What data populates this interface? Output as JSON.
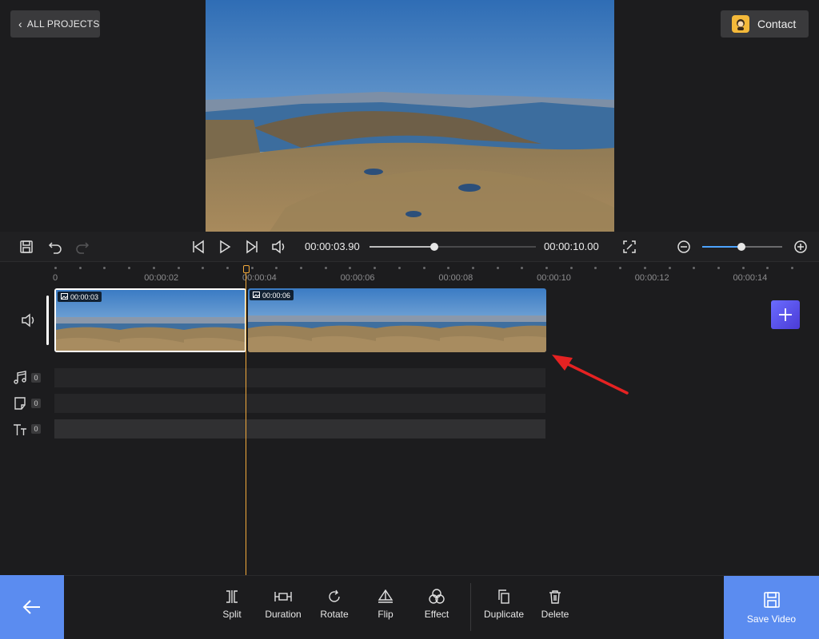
{
  "header": {
    "all_projects_label": "ALL PROJECTS",
    "contact_label": "Contact"
  },
  "transport": {
    "current_time": "00:00:03.90",
    "total_time": "00:00:10.00",
    "progress_fraction": 0.39,
    "zoom_fraction": 0.49,
    "icons": [
      "save-icon",
      "undo-icon",
      "redo-icon",
      "skip-back-icon",
      "play-icon",
      "skip-forward-icon",
      "volume-icon",
      "fullscreen-icon",
      "zoom-out-icon",
      "zoom-in-icon"
    ]
  },
  "ruler": {
    "labels": [
      "0",
      "00:00:02",
      "00:00:04",
      "00:00:06",
      "00:00:08",
      "00:00:10",
      "00:00:12",
      "00:00:14"
    ]
  },
  "clips": [
    {
      "duration": "00:00:03",
      "selected": true
    },
    {
      "duration": "00:00:06",
      "selected": false
    }
  ],
  "tracks": {
    "music_count": "0",
    "sticker_count": "0",
    "text_count": "0"
  },
  "toolbar": {
    "split": "Split",
    "duration": "Duration",
    "rotate": "Rotate",
    "flip": "Flip",
    "effect": "Effect",
    "duplicate": "Duplicate",
    "delete": "Delete",
    "save_video": "Save Video"
  },
  "colors": {
    "accent_blue": "#5b8cf0",
    "playhead": "#f2a93b",
    "annotation_arrow": "#e52222",
    "add_button": "#5a52ee"
  }
}
